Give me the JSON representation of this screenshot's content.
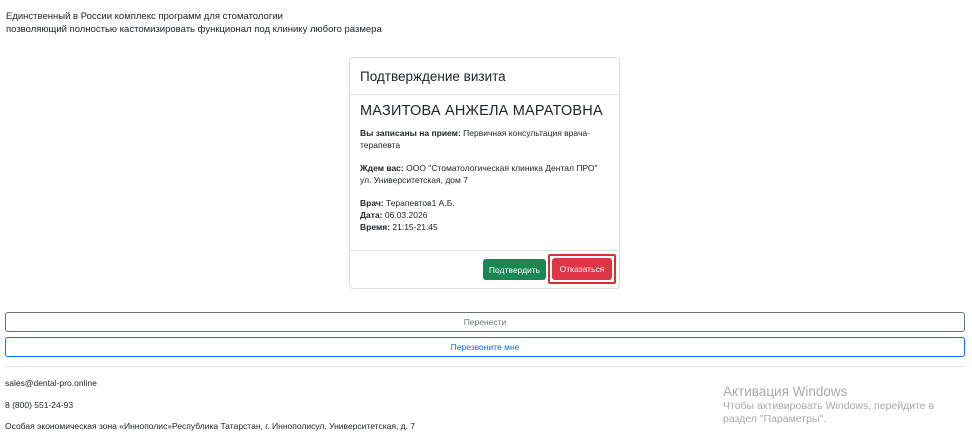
{
  "tagline": {
    "line1": "Единственный в России комплекс программ для стоматологии",
    "line2": "позволяющий полностью кастомизировать функционал под клинику любого размера"
  },
  "card": {
    "header": "Подтверждение визита",
    "patient_name": "МАЗИТОВА АНЖЕЛА МАРАТОВНА",
    "appointment_label": "Вы записаны на прием:",
    "appointment_value": " Первичная консультация врача-терапевта",
    "waiting_label": "Ждем вас:",
    "waiting_value": " ООО \"Стоматологическая клиника Дентал ПРО\" ул. Университетская, дом 7",
    "doctor_label": "Врач:",
    "doctor_value": " Терапевтов1 А.Б.",
    "date_label": "Дата:",
    "date_value": " 06.03.2026",
    "time_label": "Время:",
    "time_value": " 21:15-21:45",
    "confirm_label": "Подтвердить",
    "decline_label": "Отказаться"
  },
  "actions": {
    "reschedule_label": "Перенести",
    "callback_label": "Перезвоните мне"
  },
  "footer": {
    "email": "sales@dental-pro.online",
    "phone": "8 (800) 551-24-93",
    "address": "Особая экономическая зона «Иннополис»Республика Татарстан, г. Иннополисул. Университетская, д. 7"
  },
  "watermark": {
    "title": "Активация Windows",
    "line1": "Чтобы активировать Windows, перейдите в",
    "line2": "раздел \"Параметры\"."
  }
}
